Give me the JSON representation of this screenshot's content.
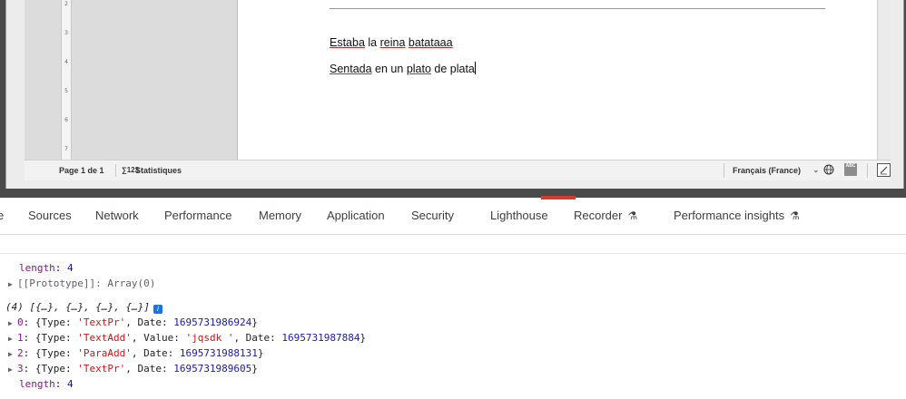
{
  "document": {
    "line1": {
      "w1": "Estaba",
      "w2": " la ",
      "w3": "reina",
      "w4": " ",
      "w5": "batataaa"
    },
    "line2": {
      "w1": "Sentada",
      "w2": " en un ",
      "w3": "plato",
      "w4": " de plata"
    },
    "ruler_marks": [
      "2",
      "3",
      "4",
      "5",
      "6",
      "7"
    ]
  },
  "statusbar": {
    "page": "Page 1 de 1",
    "stats_icon": "∑123",
    "stats_label": "Statistiques",
    "language": "Français (France)",
    "chevron": "⌄",
    "spell_icon": "ABC",
    "globe_icon": "globe-icon",
    "track_changes_icon": "track-changes-icon"
  },
  "devtools": {
    "tabs": {
      "partial": "e",
      "sources": "Sources",
      "network": "Network",
      "performance": "Performance",
      "memory": "Memory",
      "application": "Application",
      "security": "Security",
      "lighthouse": "Lighthouse",
      "recorder": "Recorder",
      "perf_insights": "Performance insights"
    },
    "flask_icon": "⚗"
  },
  "console": {
    "length_key": "length",
    "length_val": "4",
    "prototype": "[[Prototype]]: Array(0)",
    "array_summary": "(4) [{…}, {…}, {…}, {…}]",
    "info_badge": "i",
    "items": [
      {
        "idx": "0",
        "type": "'TextPr'",
        "date": "1695731986924"
      },
      {
        "idx": "1",
        "type": "'TextAdd'",
        "value": "'jqsdk '",
        "date": "1695731987884"
      },
      {
        "idx": "2",
        "type": "'ParaAdd'",
        "date": "1695731988131"
      },
      {
        "idx": "3",
        "type": "'TextPr'",
        "date": "1695731989605"
      }
    ],
    "length2_val": "4"
  },
  "colors": {
    "accent": "#1a73e8",
    "resizer": "#d43c2c",
    "spell_underline": "#d02020"
  }
}
